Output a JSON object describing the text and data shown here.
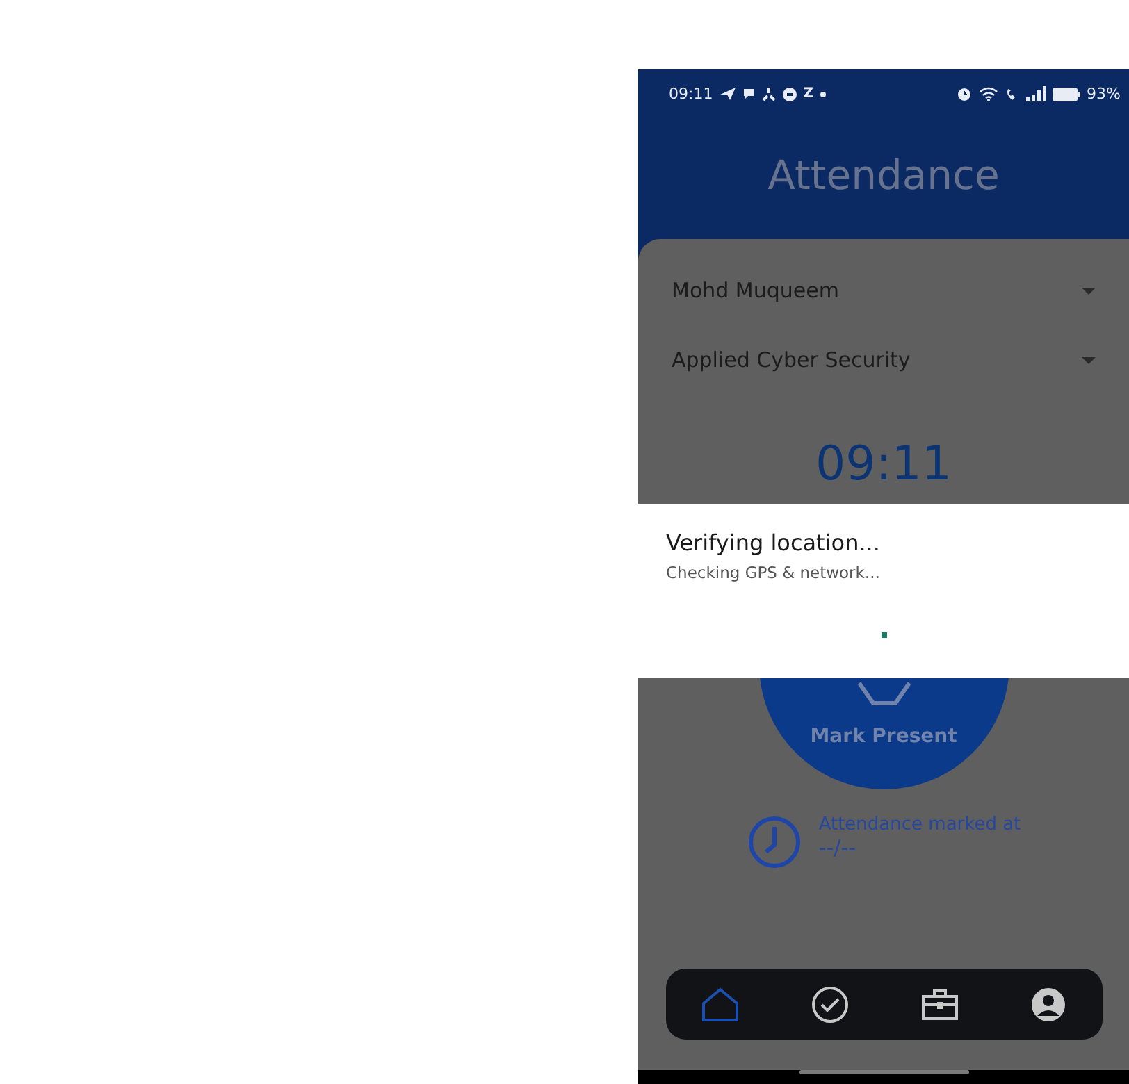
{
  "status_bar": {
    "time": "09:11",
    "notification_letter": "Z",
    "battery": "93%"
  },
  "header": {
    "title": "Attendance"
  },
  "dropdowns": [
    {
      "value": "Mohd Muqueem"
    },
    {
      "value": "Applied Cyber Security"
    }
  ],
  "clock": "09:11",
  "mark_button": {
    "label": "Mark Present"
  },
  "attendance": {
    "label": "Attendance marked at",
    "time": "--/--"
  },
  "nav": [
    {
      "kind": "home",
      "selected": true
    },
    {
      "kind": "check",
      "selected": false
    },
    {
      "kind": "briefcase",
      "selected": false
    },
    {
      "kind": "profile",
      "selected": false
    }
  ],
  "dialog": {
    "title": "Verifying location...",
    "message": "Checking GPS & network..."
  }
}
